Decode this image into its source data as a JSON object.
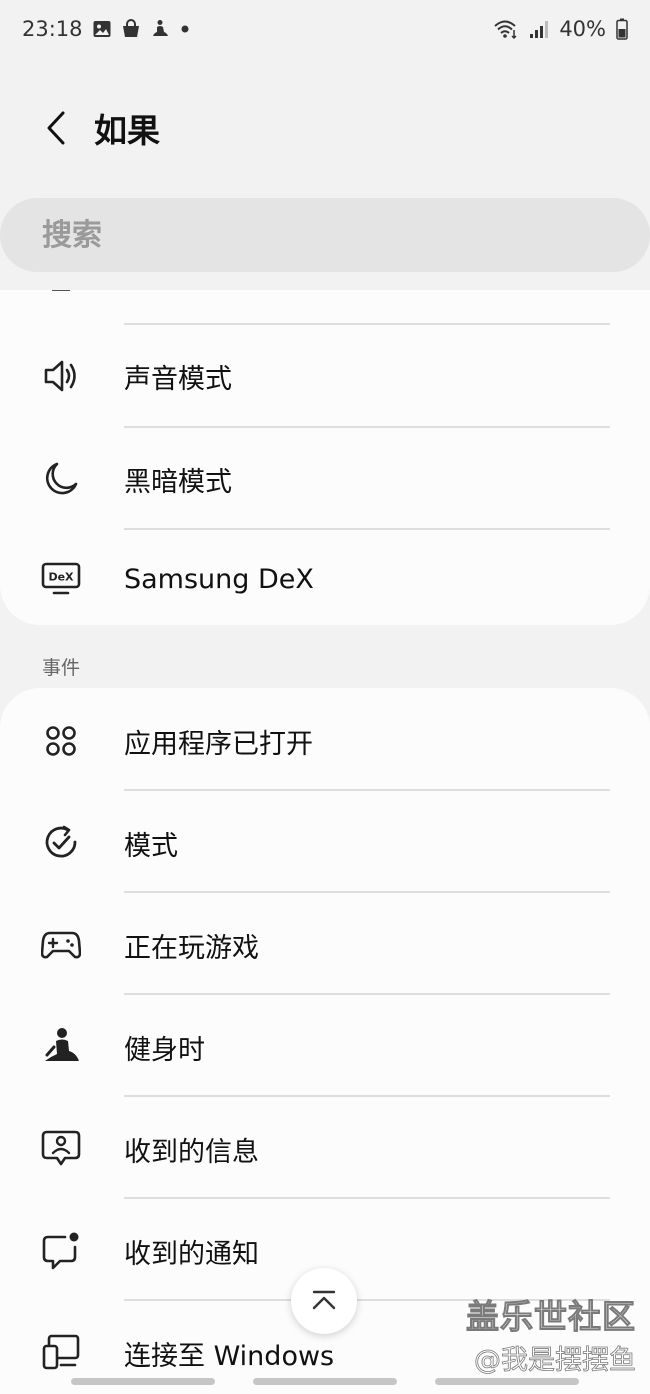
{
  "status_bar": {
    "time": "23:18",
    "battery": "40%"
  },
  "header": {
    "title": "如果"
  },
  "search": {
    "placeholder": "搜索"
  },
  "top_card": {
    "items": [
      {
        "label": "声音模式",
        "icon": "speaker-icon"
      },
      {
        "label": "黑暗模式",
        "icon": "moon-icon"
      },
      {
        "label": "Samsung DeX",
        "icon": "dex-monitor-icon"
      }
    ]
  },
  "events_section": {
    "label": "事件",
    "items": [
      {
        "label": "应用程序已打开",
        "icon": "apps-grid-icon"
      },
      {
        "label": "模式",
        "icon": "mode-check-icon"
      },
      {
        "label": "正在玩游戏",
        "icon": "gamepad-icon"
      },
      {
        "label": "健身时",
        "icon": "exercise-person-icon"
      },
      {
        "label": "收到的信息",
        "icon": "message-person-icon"
      },
      {
        "label": "收到的通知",
        "icon": "notification-bubble-icon"
      },
      {
        "label": "连接至 Windows",
        "icon": "windows-link-icon"
      }
    ]
  },
  "watermark": {
    "title": "盖乐世社区",
    "user": "@我是摆摆鱼"
  },
  "colors": {
    "background": "#f2f2f2",
    "card": "#fcfcfc",
    "search_bg": "#e4e4e4",
    "divider": "#dedede",
    "text": "#111111",
    "secondary_text": "#666666"
  }
}
